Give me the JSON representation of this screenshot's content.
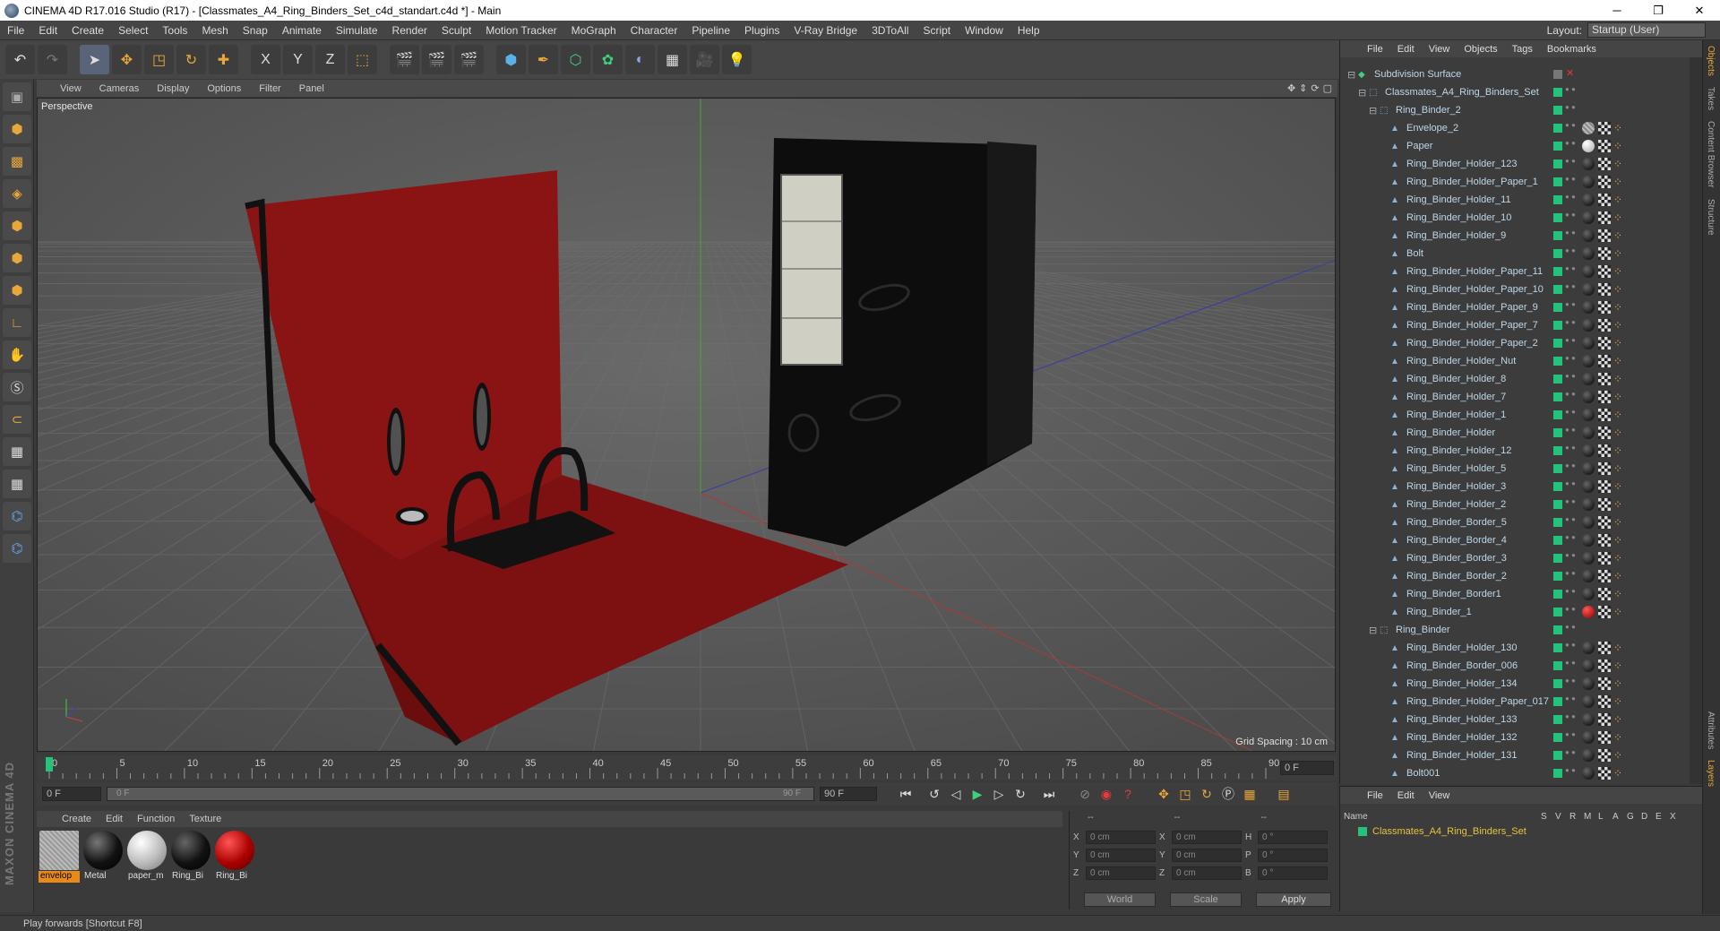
{
  "window": {
    "title": "CINEMA 4D R17.016 Studio (R17) - [Classmates_A4_Ring_Binders_Set_c4d_standart.c4d *] - Main",
    "controls": [
      "─",
      "❐",
      "✕"
    ]
  },
  "menu": [
    "File",
    "Edit",
    "Create",
    "Select",
    "Tools",
    "Mesh",
    "Snap",
    "Animate",
    "Simulate",
    "Render",
    "Sculpt",
    "Motion Tracker",
    "MoGraph",
    "Character",
    "Pipeline",
    "Plugins",
    "V-Ray Bridge",
    "3DToAll",
    "Script",
    "Window",
    "Help"
  ],
  "layout": {
    "label": "Layout:",
    "value": "Startup (User)"
  },
  "toolbar_axes": [
    "X",
    "Y",
    "Z"
  ],
  "viewport": {
    "menu": [
      "View",
      "Cameras",
      "Display",
      "Options",
      "Filter",
      "Panel"
    ],
    "label": "Perspective",
    "grid_spacing": "Grid Spacing : 10 cm"
  },
  "timeline": {
    "ticks": [
      "0",
      "5",
      "10",
      "15",
      "20",
      "25",
      "30",
      "35",
      "40",
      "45",
      "50",
      "55",
      "60",
      "65",
      "70",
      "75",
      "80",
      "85",
      "90"
    ],
    "current_frame": "0 F",
    "start": "0 F",
    "range_start": "0 F",
    "range_end": "90 F",
    "end": "90 F"
  },
  "materials": {
    "menu": [
      "Create",
      "Edit",
      "Function",
      "Texture"
    ],
    "items": [
      {
        "label": "envelop",
        "selected": true
      },
      {
        "label": "Metal",
        "selected": false
      },
      {
        "label": "paper_m",
        "selected": false
      },
      {
        "label": "Ring_Bi",
        "selected": false
      },
      {
        "label": "Ring_Bi",
        "selected": false
      }
    ]
  },
  "coords": {
    "head": [
      "--",
      "--",
      "--"
    ],
    "rows": [
      {
        "a": "X",
        "av": "0 cm",
        "b": "X",
        "bv": "0 cm",
        "c": "H",
        "cv": "0 °"
      },
      {
        "a": "Y",
        "av": "0 cm",
        "b": "Y",
        "bv": "0 cm",
        "c": "P",
        "cv": "0 °"
      },
      {
        "a": "Z",
        "av": "0 cm",
        "b": "Z",
        "bv": "0 cm",
        "c": "B",
        "cv": "0 °"
      }
    ],
    "mode": "World",
    "scale": "Scale",
    "apply": "Apply"
  },
  "objects": {
    "menu": [
      "File",
      "Edit",
      "View",
      "Objects",
      "Tags",
      "Bookmarks"
    ],
    "items": [
      {
        "name": "Subdivision Surface",
        "level": 0,
        "tag": "none"
      },
      {
        "name": "Classmates_A4_Ring_Binders_Set",
        "level": 1,
        "tag": "none"
      },
      {
        "name": "Ring_Binder_2",
        "level": 2,
        "tag": "none"
      },
      {
        "name": "Envelope_2",
        "level": 3,
        "tag": "gray"
      },
      {
        "name": "Paper",
        "level": 3,
        "tag": "white"
      },
      {
        "name": "Ring_Binder_Holder_123",
        "level": 3,
        "tag": "black"
      },
      {
        "name": "Ring_Binder_Holder_Paper_1",
        "level": 3,
        "tag": "black"
      },
      {
        "name": "Ring_Binder_Holder_11",
        "level": 3,
        "tag": "black"
      },
      {
        "name": "Ring_Binder_Holder_10",
        "level": 3,
        "tag": "black"
      },
      {
        "name": "Ring_Binder_Holder_9",
        "level": 3,
        "tag": "black"
      },
      {
        "name": "Bolt",
        "level": 3,
        "tag": "black"
      },
      {
        "name": "Ring_Binder_Holder_Paper_11",
        "level": 3,
        "tag": "black"
      },
      {
        "name": "Ring_Binder_Holder_Paper_10",
        "level": 3,
        "tag": "black"
      },
      {
        "name": "Ring_Binder_Holder_Paper_9",
        "level": 3,
        "tag": "black"
      },
      {
        "name": "Ring_Binder_Holder_Paper_7",
        "level": 3,
        "tag": "black"
      },
      {
        "name": "Ring_Binder_Holder_Paper_2",
        "level": 3,
        "tag": "black"
      },
      {
        "name": "Ring_Binder_Holder_Nut",
        "level": 3,
        "tag": "black"
      },
      {
        "name": "Ring_Binder_Holder_8",
        "level": 3,
        "tag": "black"
      },
      {
        "name": "Ring_Binder_Holder_7",
        "level": 3,
        "tag": "black"
      },
      {
        "name": "Ring_Binder_Holder_1",
        "level": 3,
        "tag": "black"
      },
      {
        "name": "Ring_Binder_Holder",
        "level": 3,
        "tag": "black"
      },
      {
        "name": "Ring_Binder_Holder_12",
        "level": 3,
        "tag": "black"
      },
      {
        "name": "Ring_Binder_Holder_5",
        "level": 3,
        "tag": "black"
      },
      {
        "name": "Ring_Binder_Holder_3",
        "level": 3,
        "tag": "black"
      },
      {
        "name": "Ring_Binder_Holder_2",
        "level": 3,
        "tag": "black"
      },
      {
        "name": "Ring_Binder_Border_5",
        "level": 3,
        "tag": "black"
      },
      {
        "name": "Ring_Binder_Border_4",
        "level": 3,
        "tag": "black"
      },
      {
        "name": "Ring_Binder_Border_3",
        "level": 3,
        "tag": "black"
      },
      {
        "name": "Ring_Binder_Border_2",
        "level": 3,
        "tag": "black"
      },
      {
        "name": "Ring_Binder_Border1",
        "level": 3,
        "tag": "black"
      },
      {
        "name": "Ring_Binder_1",
        "level": 3,
        "tag": "red"
      },
      {
        "name": "Ring_Binder",
        "level": 2,
        "tag": "none"
      },
      {
        "name": "Ring_Binder_Holder_130",
        "level": 3,
        "tag": "black"
      },
      {
        "name": "Ring_Binder_Border_006",
        "level": 3,
        "tag": "black"
      },
      {
        "name": "Ring_Binder_Holder_134",
        "level": 3,
        "tag": "black"
      },
      {
        "name": "Ring_Binder_Holder_Paper_017",
        "level": 3,
        "tag": "black"
      },
      {
        "name": "Ring_Binder_Holder_133",
        "level": 3,
        "tag": "black"
      },
      {
        "name": "Ring_Binder_Holder_132",
        "level": 3,
        "tag": "black"
      },
      {
        "name": "Ring_Binder_Holder_131",
        "level": 3,
        "tag": "black"
      },
      {
        "name": "Bolt001",
        "level": 3,
        "tag": "black"
      }
    ]
  },
  "layers": {
    "menu": [
      "File",
      "Edit",
      "View"
    ],
    "header": [
      "Name",
      "S",
      "V",
      "R",
      "M",
      "L",
      "A",
      "G",
      "D",
      "E",
      "X"
    ],
    "row": "Classmates_A4_Ring_Binders_Set"
  },
  "side_tabs": [
    "Objects",
    "Takes",
    "Content Browser",
    "Structure"
  ],
  "side_tabs_bottom": [
    "Attributes",
    "Layers"
  ],
  "brand": "MAXON CINEMA 4D",
  "status": "Play forwards [Shortcut F8]",
  "colors": {
    "visible": "#21c47a",
    "accent": "#e88a1a",
    "binder_red": "#8a1414"
  }
}
